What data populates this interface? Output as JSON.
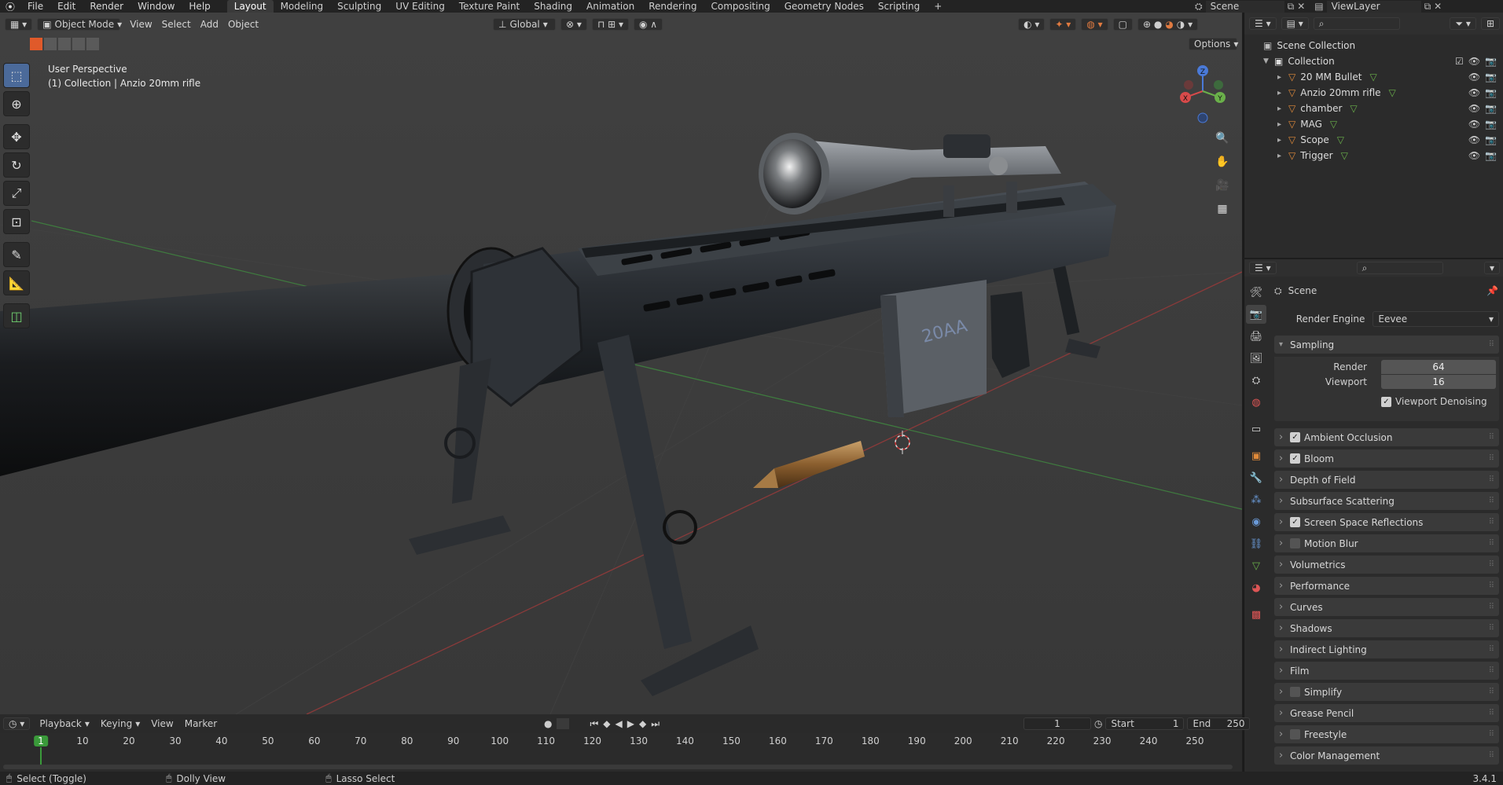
{
  "app": {
    "version": "3.4.1"
  },
  "menu": [
    "File",
    "Edit",
    "Render",
    "Window",
    "Help"
  ],
  "workspaces": [
    {
      "label": "Layout",
      "active": true
    },
    {
      "label": "Modeling"
    },
    {
      "label": "Sculpting"
    },
    {
      "label": "UV Editing"
    },
    {
      "label": "Texture Paint"
    },
    {
      "label": "Shading"
    },
    {
      "label": "Animation"
    },
    {
      "label": "Rendering"
    },
    {
      "label": "Compositing"
    },
    {
      "label": "Geometry Nodes"
    },
    {
      "label": "Scripting"
    }
  ],
  "add_workspace": "+",
  "scene_selector": "Scene",
  "viewlayer_selector": "ViewLayer",
  "viewport_header": {
    "mode": "Object Mode",
    "menus": [
      "View",
      "Select",
      "Add",
      "Object"
    ],
    "transform_orientation": "Global",
    "options": "Options"
  },
  "viewport_overlay": {
    "line1": "User Perspective",
    "line2": "(1) Collection | Anzio 20mm rifle"
  },
  "gizmo": {
    "x": "X",
    "y": "Y",
    "z": "Z"
  },
  "outliner": {
    "root": "Scene Collection",
    "collection": "Collection",
    "objects": [
      "20 MM Bullet",
      "Anzio 20mm rifle",
      "chamber",
      "MAG",
      "Scope",
      "Trigger"
    ]
  },
  "properties": {
    "context": "Scene",
    "render_engine_label": "Render Engine",
    "render_engine": "Eevee",
    "sampling": {
      "title": "Sampling",
      "render_label": "Render",
      "render": "64",
      "viewport_label": "Viewport",
      "viewport": "16",
      "denoise": "Viewport Denoising"
    },
    "panels": [
      {
        "label": "Ambient Occlusion",
        "checkbox": "on"
      },
      {
        "label": "Bloom",
        "checkbox": "on"
      },
      {
        "label": "Depth of Field",
        "checkbox": "none"
      },
      {
        "label": "Subsurface Scattering",
        "checkbox": "none"
      },
      {
        "label": "Screen Space Reflections",
        "checkbox": "on"
      },
      {
        "label": "Motion Blur",
        "checkbox": "off"
      },
      {
        "label": "Volumetrics",
        "checkbox": "none"
      },
      {
        "label": "Performance",
        "checkbox": "none"
      },
      {
        "label": "Curves",
        "checkbox": "none"
      },
      {
        "label": "Shadows",
        "checkbox": "none"
      },
      {
        "label": "Indirect Lighting",
        "checkbox": "none"
      },
      {
        "label": "Film",
        "checkbox": "none"
      },
      {
        "label": "Simplify",
        "checkbox": "off"
      },
      {
        "label": "Grease Pencil",
        "checkbox": "none"
      },
      {
        "label": "Freestyle",
        "checkbox": "off"
      },
      {
        "label": "Color Management",
        "checkbox": "none"
      }
    ]
  },
  "timeline": {
    "menus": [
      "Playback",
      "Keying",
      "View",
      "Marker"
    ],
    "current_frame": "1",
    "start_label": "Start",
    "start": "1",
    "end_label": "End",
    "end": "250",
    "ticks": [
      "1",
      "10",
      "20",
      "30",
      "40",
      "50",
      "60",
      "70",
      "80",
      "90",
      "100",
      "110",
      "120",
      "130",
      "140",
      "150",
      "160",
      "170",
      "180",
      "190",
      "200",
      "210",
      "220",
      "230",
      "240",
      "250"
    ]
  },
  "statusbar": {
    "items": [
      "Select (Toggle)",
      "Dolly View",
      "Lasso Select"
    ]
  },
  "scene_text": {
    "magazine_mark": "20AA"
  }
}
